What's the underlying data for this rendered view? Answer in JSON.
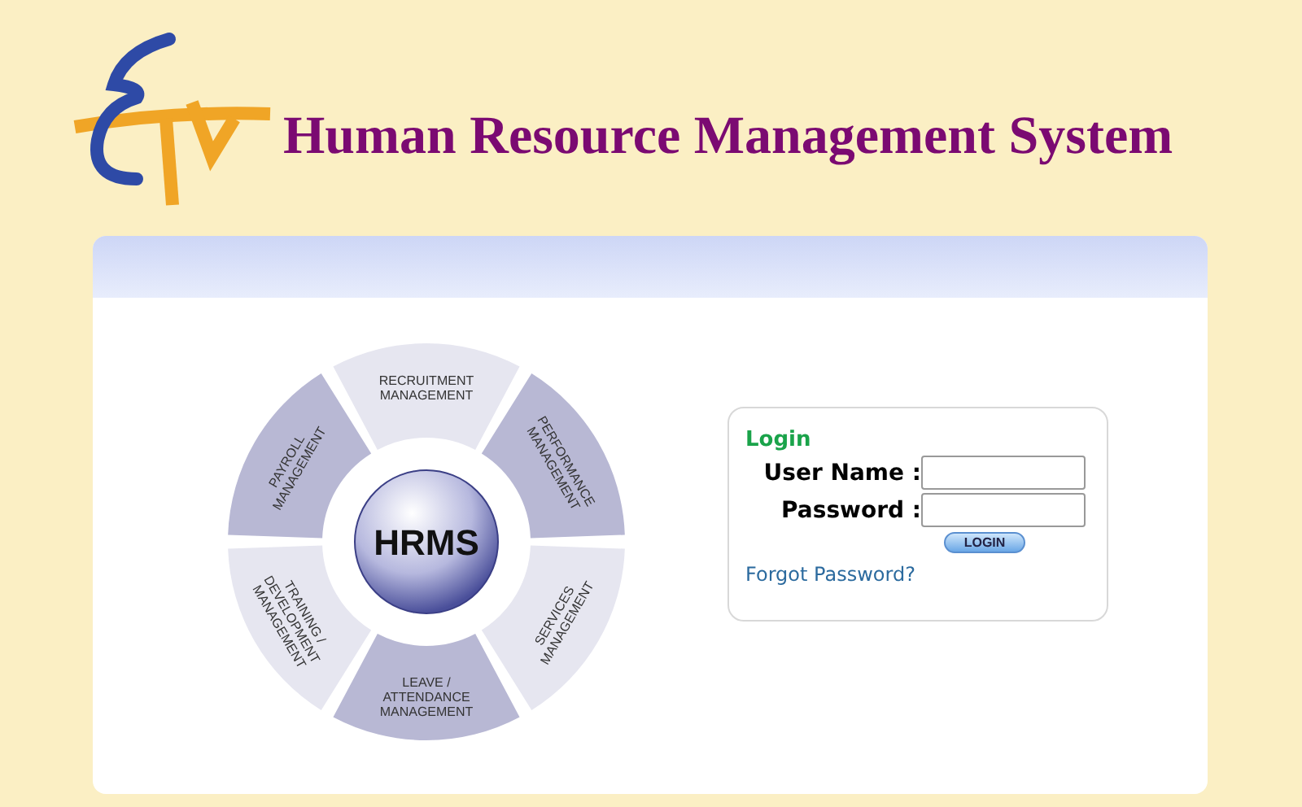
{
  "header": {
    "title": "Human Resource Management System"
  },
  "diagram": {
    "center": "HRMS",
    "segments": [
      {
        "kind": "light",
        "lines": [
          "RECRUITMENT",
          "MANAGEMENT"
        ]
      },
      {
        "kind": "dark",
        "lines": [
          "PERFORMANCE",
          "MANAGEMENT"
        ]
      },
      {
        "kind": "light",
        "lines": [
          "SERVICES",
          "MANAGEMENT"
        ]
      },
      {
        "kind": "dark",
        "lines": [
          "LEAVE /",
          "ATTENDANCE",
          "MANAGEMENT"
        ]
      },
      {
        "kind": "light",
        "lines": [
          "TRAINING /",
          "DEVELOPMENT",
          "MANAGEMENT"
        ]
      },
      {
        "kind": "dark",
        "lines": [
          "PAYROLL",
          "MANAGEMENT"
        ]
      }
    ]
  },
  "login": {
    "heading": "Login",
    "fields": [
      {
        "label": "User Name :"
      },
      {
        "label": "Password :"
      }
    ],
    "button": "LOGIN",
    "forgot": "Forgot Password?"
  }
}
